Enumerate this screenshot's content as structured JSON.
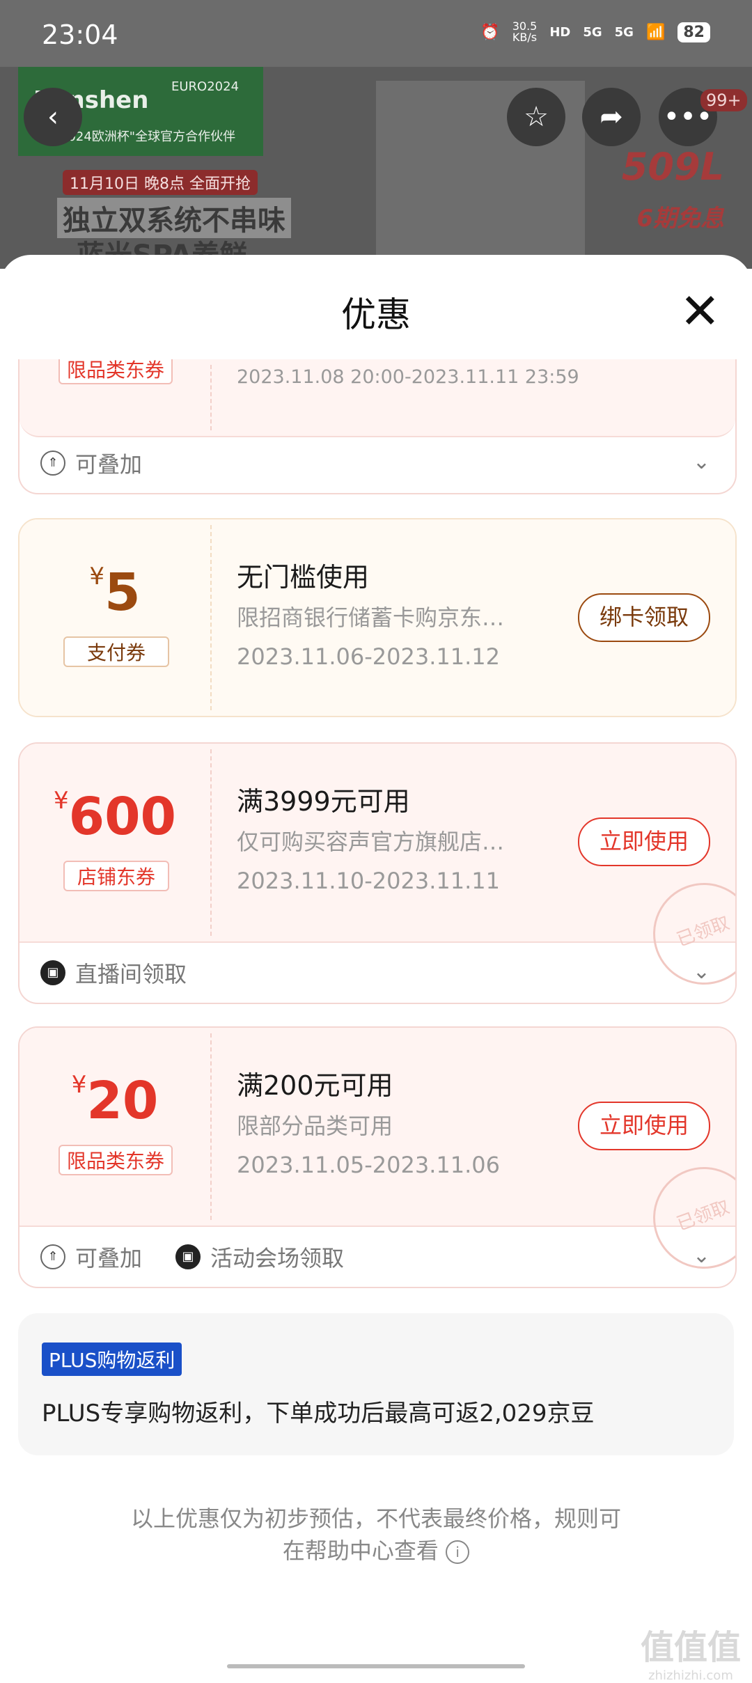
{
  "status": {
    "time": "23:04",
    "speed_top": "30.5",
    "speed_unit": "KB/s",
    "net1": "HD",
    "net2": "5G",
    "net3": "5G",
    "battery": "82"
  },
  "banner": {
    "brand": "Ronshen",
    "euro": "EURO2024",
    "partner": "2024欧洲杯\"全球官方合作伙伴",
    "date": "11月10日 晚8点 全面开抢",
    "slogan1": "独立双系统不串味",
    "slogan2": "蓝光SPA养鲜",
    "capacity": "509L",
    "free": "6期免息",
    "badge": "99+",
    "icons": {
      "back": "back-arrow-icon",
      "star": "star-icon",
      "share": "share-icon",
      "more": "more-icon"
    }
  },
  "sheet": {
    "title": "优惠"
  },
  "coupons": [
    {
      "tag": "限品类东券",
      "date": "2023.11.08 20:00-2023.11.11 23:59",
      "footer": [
        "可叠加"
      ]
    },
    {
      "yen": "¥",
      "amount": "5",
      "tag": "支付券",
      "title": "无门槛使用",
      "desc": "限招商银行储蓄卡购京东…",
      "date": "2023.11.06-2023.11.12",
      "action": "绑卡领取"
    },
    {
      "yen": "¥",
      "amount": "600",
      "tag": "店铺东券",
      "title": "满3999元可用",
      "desc": "仅可购买容声官方旗舰店…",
      "date": "2023.11.10-2023.11.11",
      "action": "立即使用",
      "stamp": "已领取",
      "footer": [
        "直播间领取"
      ]
    },
    {
      "yen": "¥",
      "amount": "20",
      "tag": "限品类东券",
      "title": "满200元可用",
      "desc": "限部分品类可用",
      "date": "2023.11.05-2023.11.06",
      "action": "立即使用",
      "stamp": "已领取",
      "footer": [
        "可叠加",
        "活动会场领取"
      ]
    }
  ],
  "plus": {
    "badge": "PLUS购物返利",
    "text": "PLUS专享购物返利，下单成功后最高可返2,029京豆"
  },
  "note": {
    "line1": "以上优惠仅为初步预估，不代表最终价格，规则可",
    "line2": "在帮助中心查看"
  },
  "watermark": {
    "main": "值值值",
    "sub": "zhizhizhi.com"
  }
}
